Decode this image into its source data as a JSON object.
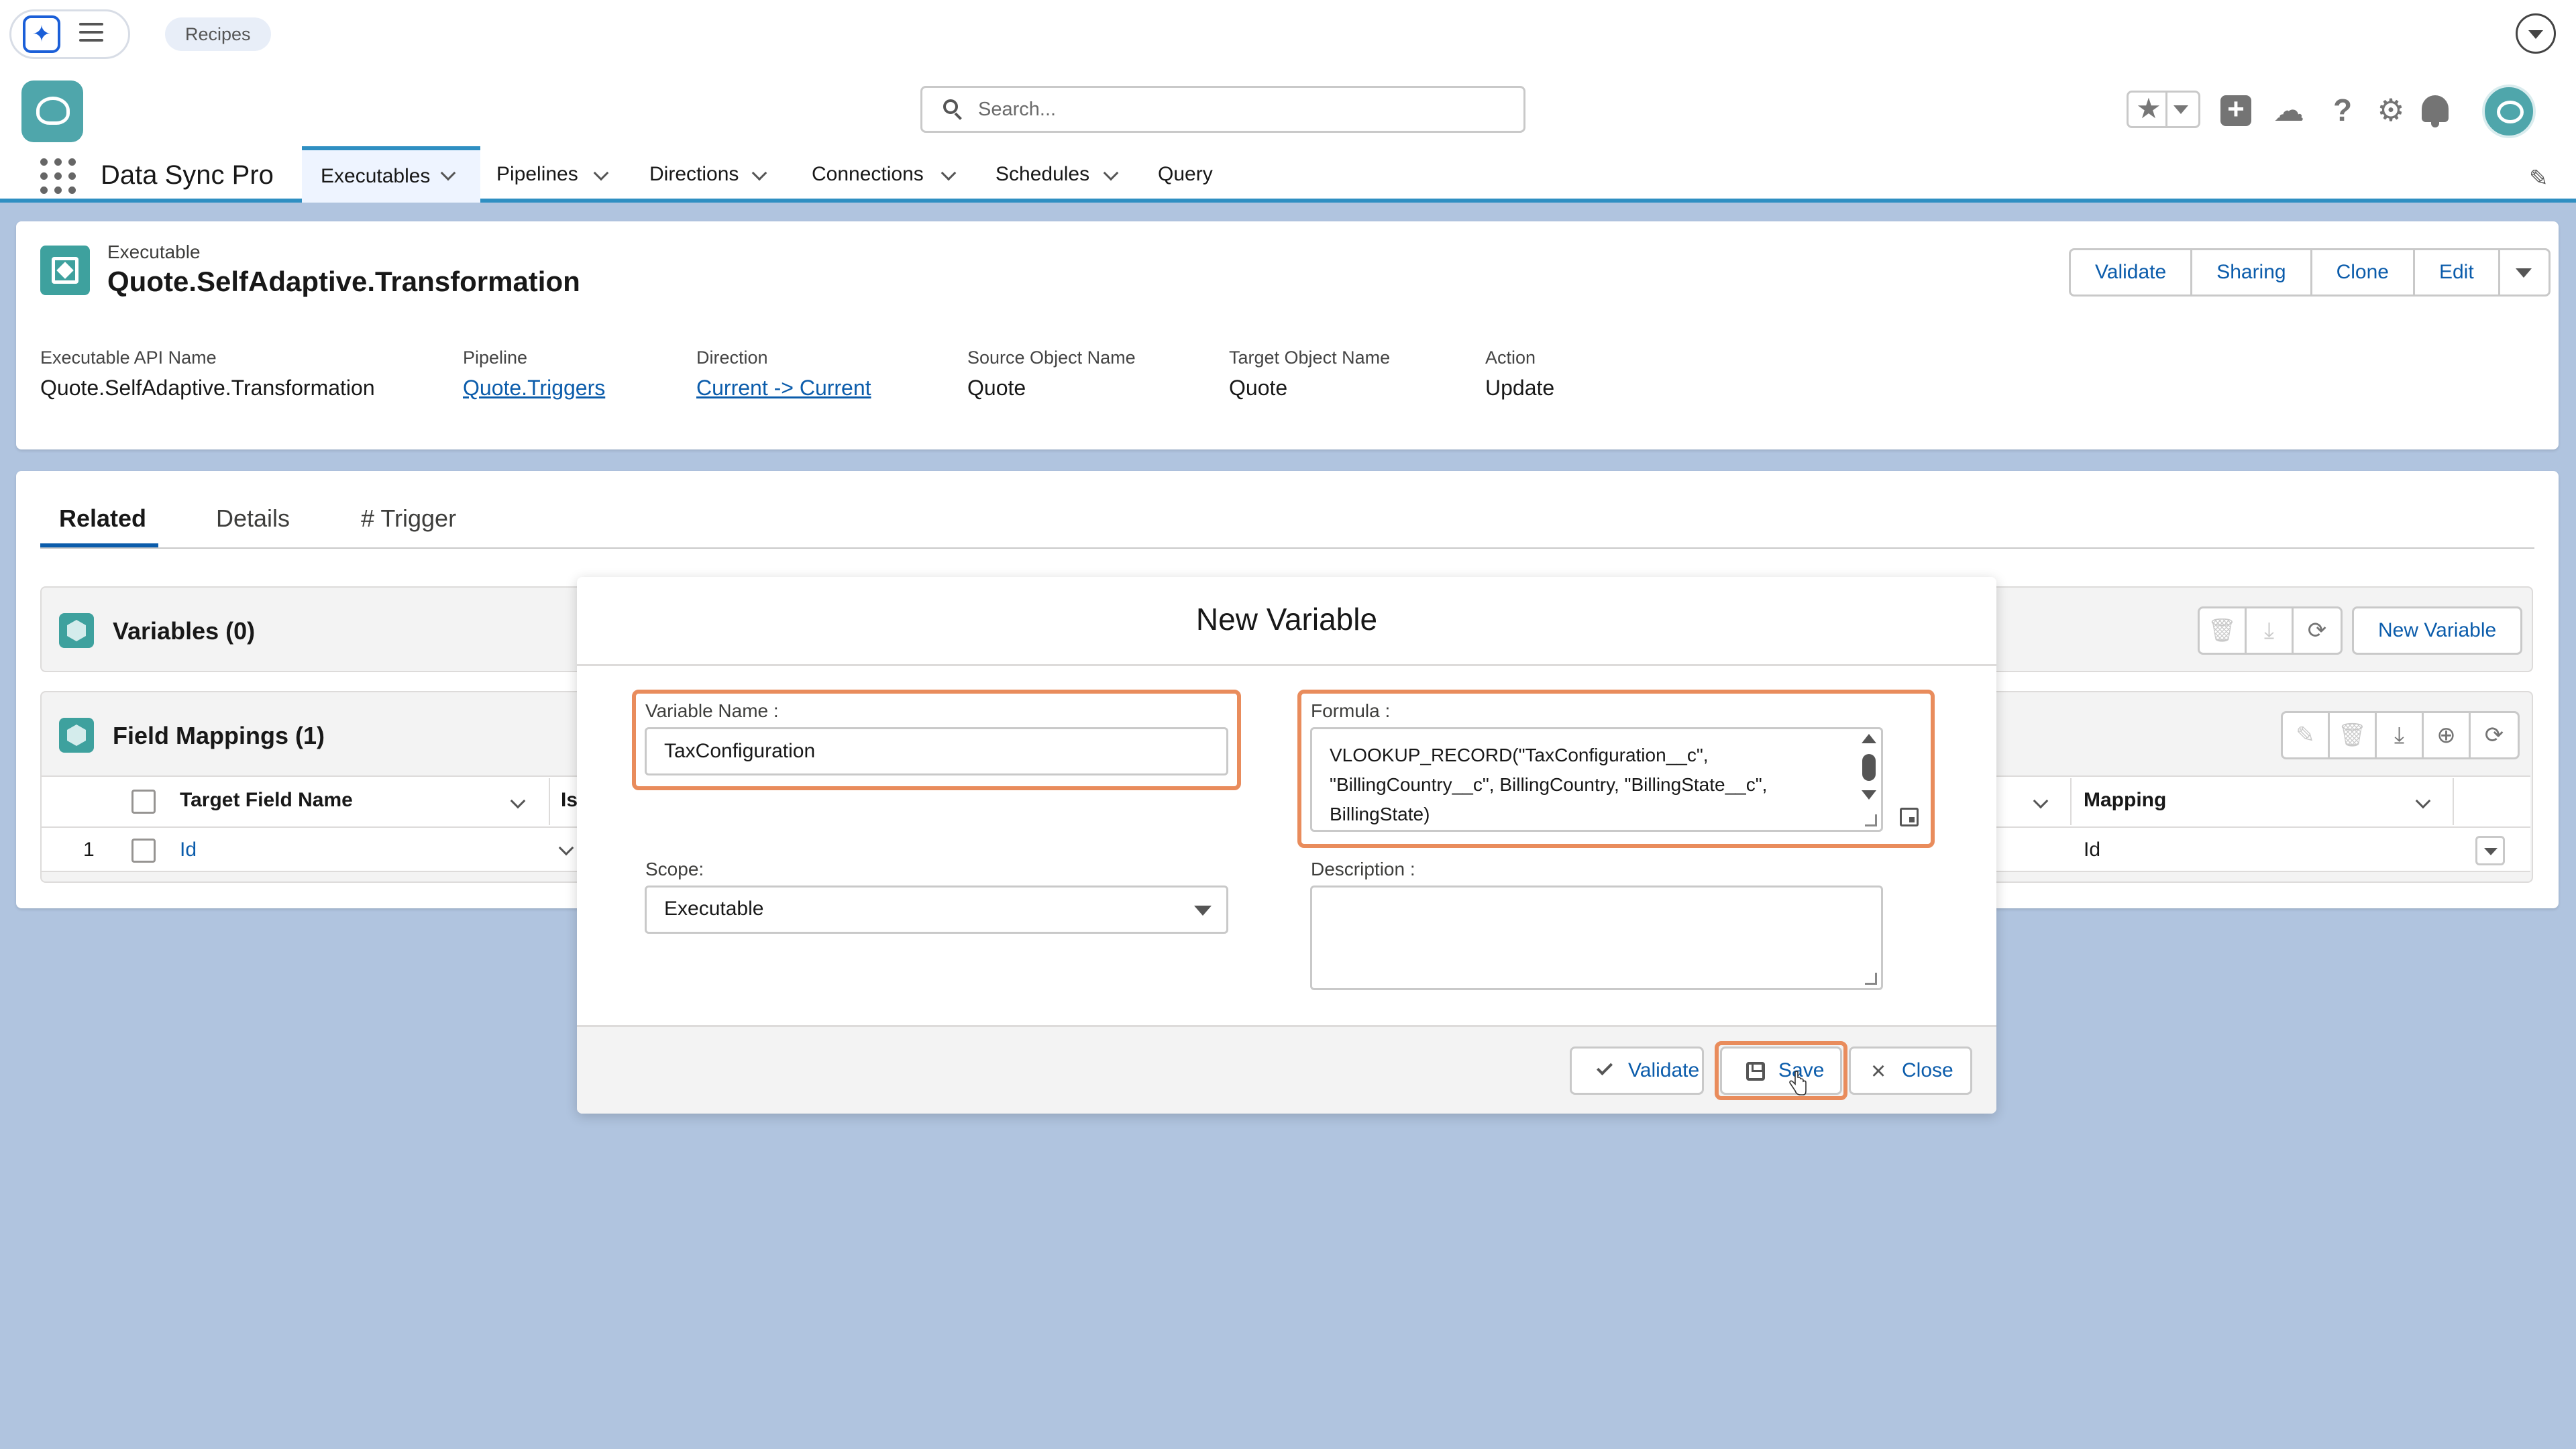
{
  "utility_bar": {
    "app_icon": "sparkle-icon",
    "menu_icon": "hamburger-icon",
    "recipes_label": "Recipes",
    "dropdown_icon": "chevron-down-icon"
  },
  "header": {
    "search_placeholder": "Search...",
    "icons": [
      "star-icon",
      "add-icon",
      "trailhead-icon",
      "help-icon",
      "gear-icon",
      "bell-icon",
      "avatar"
    ]
  },
  "nav": {
    "app_name": "Data Sync Pro",
    "items": [
      {
        "label": "Executables",
        "active": true,
        "has_menu": true
      },
      {
        "label": "Pipelines",
        "active": false,
        "has_menu": true
      },
      {
        "label": "Directions",
        "active": false,
        "has_menu": true
      },
      {
        "label": "Connections",
        "active": false,
        "has_menu": true
      },
      {
        "label": "Schedules",
        "active": false,
        "has_menu": true
      },
      {
        "label": "Query",
        "active": false,
        "has_menu": false
      }
    ]
  },
  "record": {
    "object_type": "Executable",
    "title": "Quote.SelfAdaptive.Transformation",
    "actions": [
      "Validate",
      "Sharing",
      "Clone",
      "Edit"
    ],
    "fields": [
      {
        "label": "Executable API Name",
        "value": "Quote.SelfAdaptive.Transformation",
        "link": false
      },
      {
        "label": "Pipeline",
        "value": "Quote.Triggers",
        "link": true
      },
      {
        "label": "Direction",
        "value": "Current -> Current",
        "link": true
      },
      {
        "label": "Source Object Name",
        "value": "Quote",
        "link": false
      },
      {
        "label": "Target Object Name",
        "value": "Quote",
        "link": false
      },
      {
        "label": "Action",
        "value": "Update",
        "link": false
      }
    ]
  },
  "tabs": [
    {
      "label": "Related",
      "active": true
    },
    {
      "label": "Details",
      "active": false
    },
    {
      "label": "# Trigger",
      "active": false
    }
  ],
  "variables_list": {
    "title": "Variables (0)",
    "new_button": "New Variable"
  },
  "field_mappings": {
    "title": "Field Mappings (1)",
    "columns": [
      "Target Field Name",
      "Is",
      "Mapping"
    ],
    "rows": [
      {
        "num": "1",
        "target_field": "Id",
        "mapping": "Id"
      }
    ]
  },
  "modal": {
    "title": "New Variable",
    "variable_name_label": "Variable Name :",
    "variable_name_value": "TaxConfiguration",
    "formula_label": "Formula :",
    "formula_lines": [
      "VLOOKUP_RECORD(\"TaxConfiguration__c\",",
      "\"BillingCountry__c\", BillingCountry, \"BillingState__c\",",
      "BillingState)"
    ],
    "scope_label": "Scope:",
    "scope_value": "Executable",
    "description_label": "Description :",
    "description_value": "",
    "buttons": {
      "validate": "Validate",
      "save": "Save",
      "close": "Close"
    }
  },
  "colors": {
    "accent_blue": "#0b5cab",
    "nav_active_border": "#2f8fc2",
    "highlight_orange": "#e98c5c",
    "background": "#b0c4df",
    "teal_icon": "#3ea19e"
  }
}
